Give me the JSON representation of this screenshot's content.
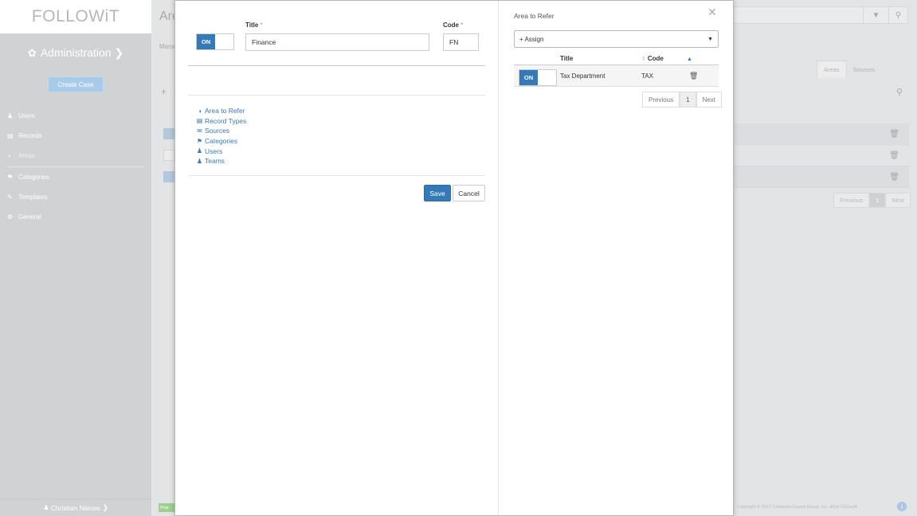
{
  "app": {
    "logo": "FOLLOWiT",
    "sidebar_title": "Administration",
    "create_case": "Create Case",
    "nav": [
      {
        "label": "Users",
        "icon": "user-icon"
      },
      {
        "label": "Records",
        "icon": "records-icon"
      },
      {
        "label": "Areas",
        "icon": "globe-icon"
      },
      {
        "label": "Categories",
        "icon": "tag-icon"
      },
      {
        "label": "Templates",
        "icon": "template-icon"
      },
      {
        "label": "General",
        "icon": "gears-icon"
      }
    ],
    "user_name": "Christian Nieves"
  },
  "background": {
    "page_title": "Are",
    "subtitle": "Mana",
    "tabs": [
      "Areas",
      "Sources"
    ],
    "pager": {
      "previous": "Previous",
      "current": "1",
      "next": "Next"
    },
    "copyright": "Copyright © 2017 Computer Expert Group, Inc. d/b/a CEGsoft",
    "badge": "Prep"
  },
  "modal": {
    "form": {
      "status": "ON",
      "title_label": "Title",
      "title_value": "Finance",
      "code_label": "Code",
      "code_value": "FN",
      "required_mark": "*"
    },
    "links": [
      {
        "label": "Area to Refer",
        "icon": "globe-icon"
      },
      {
        "label": "Record Types",
        "icon": "credit-card-icon"
      },
      {
        "label": "Sources",
        "icon": "envelope-icon"
      },
      {
        "label": "Categories",
        "icon": "tag-icon"
      },
      {
        "label": "Users",
        "icon": "user-icon"
      },
      {
        "label": "Teams",
        "icon": "group-icon"
      }
    ],
    "save": "Save",
    "cancel": "Cancel",
    "right": {
      "title": "Area to Refer",
      "assign": "+ Assign",
      "columns": {
        "title": "Title",
        "code": "Code"
      },
      "rows": [
        {
          "status": "ON",
          "title": "Tax Department",
          "code": "TAX"
        }
      ],
      "pager": {
        "previous": "Previous",
        "current": "1",
        "next": "Next"
      }
    }
  }
}
